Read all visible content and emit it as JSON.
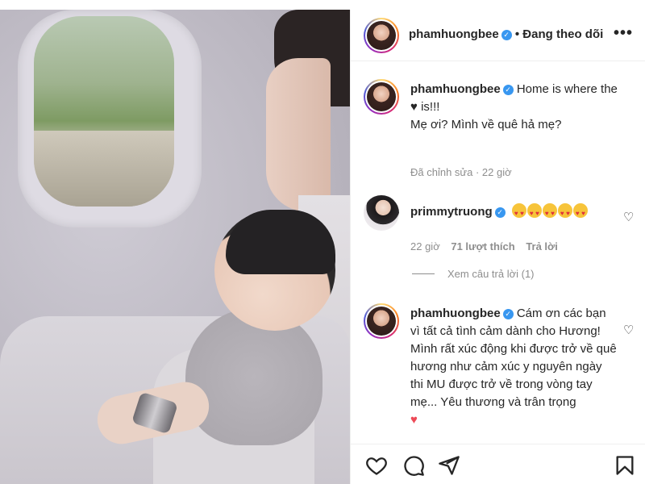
{
  "post": {
    "header": {
      "username": "phamhuongbee",
      "separator": "•",
      "follow_label": "Đang theo dõi",
      "more_label": "•••"
    },
    "caption": {
      "username": "phamhuongbee",
      "text_before_heart": "Home is where the",
      "heart": "♥",
      "text_after_heart": "is!!!",
      "line2": "Mẹ ơi? Mình về quê hả mẹ?",
      "meta": "Đã chỉnh sửa · 22 giờ"
    },
    "comments": [
      {
        "username": "primmytruong",
        "emoji_count": 5,
        "time": "22 giờ",
        "likes": "71 lượt thích",
        "reply_label": "Trả lời",
        "view_replies": "Xem câu trả lời (1)"
      },
      {
        "username": "phamhuongbee",
        "text": "Cám ơn các bạn vì tất cả tình cảm dành cho Hương! Mình rất xúc động khi được trở về quê hương như cảm xúc y nguyên ngày thi MU được trở về trong vòng tay mẹ... Yêu thương và trân trọng",
        "heart": "♥"
      }
    ]
  },
  "icons": [
    "heart-icon",
    "comment-icon",
    "share-icon",
    "bookmark-icon"
  ],
  "colors": {
    "verified": "#3897f0",
    "link": "#262626",
    "muted": "#8e8e8e",
    "red_heart": "#ed4956"
  }
}
